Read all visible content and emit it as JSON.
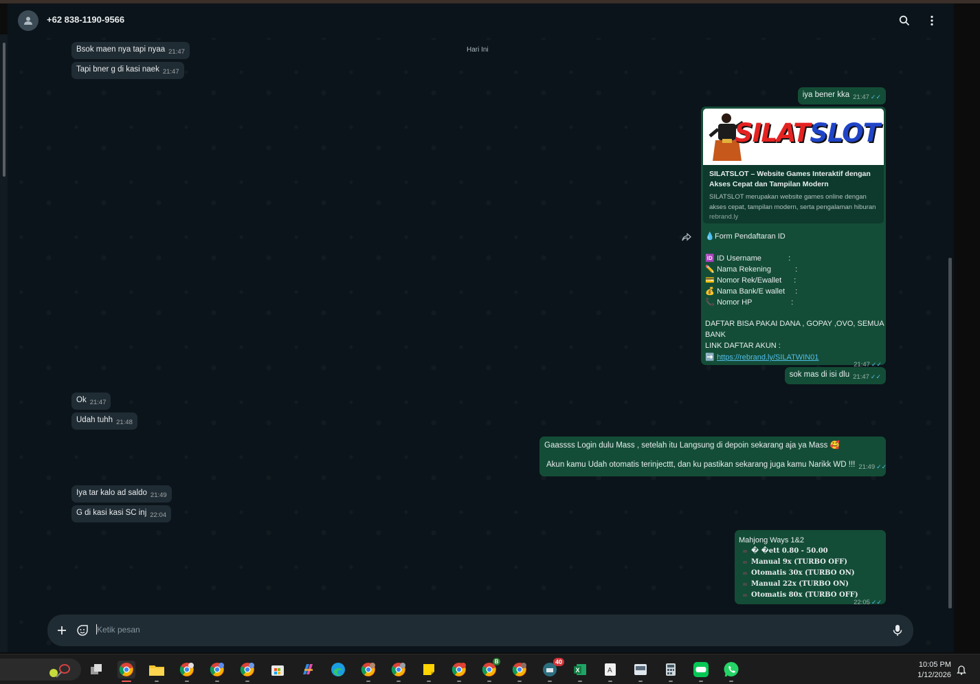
{
  "contact": {
    "name": "+62 838-1190-9566"
  },
  "date_chip": "Hari Ini",
  "incoming": [
    {
      "text": "Bsok maen nya tapi nyaa",
      "time": "21:47"
    },
    {
      "text": "Tapi bner g di kasi naek",
      "time": "21:47"
    },
    {
      "text": "Ok",
      "time": "21:47"
    },
    {
      "text": "Udah tuhh",
      "time": "21:48"
    },
    {
      "text": "Iya tar kalo ad saldo",
      "time": "21:49"
    },
    {
      "text": "G di kasi kasi SC inj",
      "time": "22:04"
    }
  ],
  "outgoing": [
    {
      "text": "iya bener kka",
      "time": "21:47"
    },
    {
      "text": "sok mas di isi dlu",
      "time": "21:47"
    },
    {
      "line1": "Gaassss Login dulu Mass  , setelah itu Langsung di depoin sekarang aja ya Mass",
      "line2": "Akun kamu Udah otomatis terinjecttt, dan ku pastikan sekarang juga kamu Narikk WD !!!",
      "time": "21:49"
    }
  ],
  "promo": {
    "logo_left": "SILAT",
    "logo_right": "SLOT",
    "title": "SILATSLOT – Website Games Interaktif dengan Akses Cepat dan Tampilan Modern",
    "description": "SILATSLOT merupakan website games online dengan akses cepat, tampilan modern, serta pengalaman hiburan",
    "domain": "rebrand.ly",
    "form_title": "Form Pendaftaran ID",
    "fields": [
      {
        "icon": "id-card-icon",
        "label": "ID Username",
        "sep": ":"
      },
      {
        "icon": "pencil-icon",
        "label": "Nama Rekening",
        "sep": ":"
      },
      {
        "icon": "card-icon",
        "label": "Nomor Rek/Ewallet",
        "sep": ":"
      },
      {
        "icon": "money-bag-icon",
        "label": "Nama Bank/E wallet",
        "sep": ":"
      },
      {
        "icon": "phone-icon",
        "label": "Nomor HP",
        "sep": ":"
      }
    ],
    "daftar_line1": "DAFTAR BISA PAKAI DANA , GOPAY ,OVO, SEMUA",
    "daftar_line2": "BANK",
    "link_label": "LINK DAFTAR AKUN :",
    "link_url": "https://rebrand.ly/SILATWIN01",
    "time": "21:47"
  },
  "mahjong": {
    "title": "Mahjong Ways 1&2",
    "lines": [
      "� �ett 0.80 - 50.00",
      "Manual    9x (TURBO OFF)",
      "Otomatis 30x (TURBO ON)",
      "Manual   22x (TURBO ON)",
      "Otomatis 80x (TURBO OFF)"
    ],
    "time": "22:05"
  },
  "composer": {
    "placeholder": "Ketik pesan"
  },
  "taskbar": {
    "time": "10:05 PM",
    "date": "1/12/2026",
    "badge_count": "40",
    "chrome_badge_b": "B"
  },
  "colors": {
    "incoming_bubble": "#202c33",
    "outgoing_bubble": "#005c4b",
    "link": "#53bdeb",
    "chat_bg": "#0b141a"
  }
}
